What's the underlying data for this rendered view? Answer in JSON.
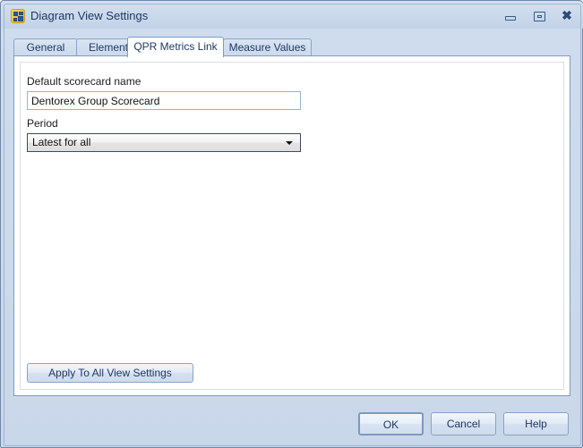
{
  "window": {
    "title": "Diagram View Settings",
    "icon": "diagram-view-settings-icon",
    "controls": {
      "minimize": "minimize-icon",
      "maximize": "maximize-icon",
      "close": "close-icon"
    }
  },
  "tabs": [
    {
      "label": "General",
      "active": false
    },
    {
      "label": "Elements",
      "active": false
    },
    {
      "label": "QPR Metrics Link",
      "active": true
    },
    {
      "label": "Measure Values",
      "active": false
    }
  ],
  "form": {
    "scorecard_label": "Default scorecard name",
    "scorecard_value": "Dentorex Group Scorecard",
    "scorecard_placeholder": "",
    "period_label": "Period",
    "period_value": "Latest for all",
    "period_options": [
      "Latest for all"
    ]
  },
  "actions": {
    "apply_all": "Apply To All View Settings",
    "ok": "OK",
    "cancel": "Cancel",
    "help": "Help"
  },
  "colors": {
    "window_bg": "#cfdcee",
    "titlebar": "#cbd9ec",
    "accent_text": "#1f3864",
    "panel_bg": "#ffffff",
    "border": "#7f9cc0"
  }
}
